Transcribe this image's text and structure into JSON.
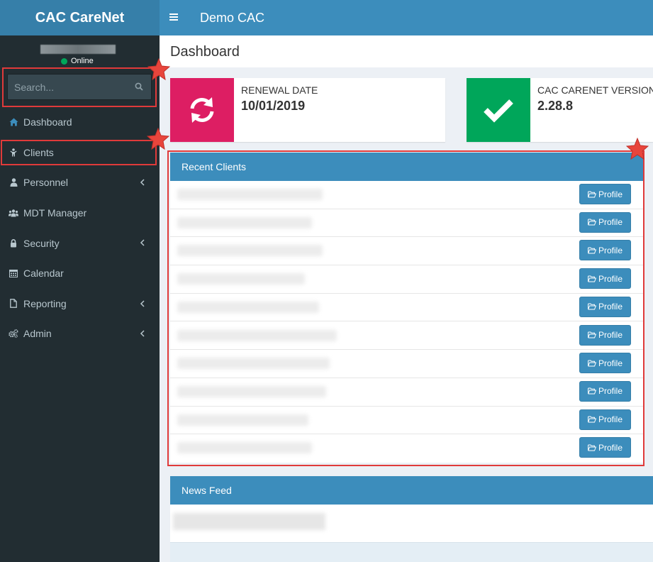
{
  "app": {
    "logo": "CAC CareNet",
    "header_title": "Demo CAC",
    "page_title": "Dashboard"
  },
  "user": {
    "status": "Online"
  },
  "search": {
    "placeholder": "Search..."
  },
  "sidebar": {
    "items": [
      {
        "label": "Dashboard",
        "icon": "home-icon",
        "active": true,
        "has_submenu": false
      },
      {
        "label": "Clients",
        "icon": "child-icon",
        "active": false,
        "has_submenu": false
      },
      {
        "label": "Personnel",
        "icon": "user-icon",
        "active": false,
        "has_submenu": true
      },
      {
        "label": "MDT Manager",
        "icon": "users-icon",
        "active": false,
        "has_submenu": false
      },
      {
        "label": "Security",
        "icon": "lock-icon",
        "active": false,
        "has_submenu": true
      },
      {
        "label": "Calendar",
        "icon": "calendar-icon",
        "active": false,
        "has_submenu": false
      },
      {
        "label": "Reporting",
        "icon": "file-icon",
        "active": false,
        "has_submenu": true
      },
      {
        "label": "Admin",
        "icon": "cogs-icon",
        "active": false,
        "has_submenu": true
      }
    ]
  },
  "info_boxes": [
    {
      "label": "RENEWAL DATE",
      "value": "10/01/2019",
      "icon": "refresh-icon",
      "color": "#dd1e63"
    },
    {
      "label": "CAC CARENET VERSION",
      "value": "2.28.8",
      "icon": "check-icon",
      "color": "#00a65a"
    }
  ],
  "recent_clients": {
    "title": "Recent Clients",
    "button_label": "Profile",
    "row_count": 10
  },
  "news_feed": {
    "title": "News Feed"
  },
  "colors": {
    "primary": "#3c8dbc",
    "sidebar": "#222d32",
    "annotation": "#e03a3a",
    "star": "#e8453c"
  }
}
